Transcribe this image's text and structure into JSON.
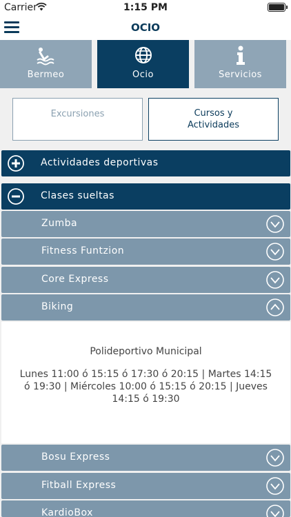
{
  "status": {
    "carrier": "Carrier",
    "time": "1:15 PM"
  },
  "nav": {
    "title": "OCIO"
  },
  "tabs": [
    {
      "label": "Bermeo",
      "icon": "swimmer-icon"
    },
    {
      "label": "Ocio",
      "icon": "globe-icon"
    },
    {
      "label": "Servicios",
      "icon": "info-icon"
    }
  ],
  "segments": {
    "excursiones": "Excursiones",
    "cursos_line1": "Cursos y",
    "cursos_line2": "Actividades"
  },
  "sections": {
    "deportivas": "Actividades deportivas",
    "clases": "Clases sueltas"
  },
  "items": {
    "zumba": "Zumba",
    "fitness": "Fitness Funtzion",
    "core": "Core Express",
    "biking": "Biking",
    "bosu": "Bosu Express",
    "fitball": "Fitball Express",
    "kardio": "KardioBox"
  },
  "detail": {
    "place": "Polideportivo Municipal",
    "hours": "Lunes 11:00 ó 15:15 ó 17:30 ó 20:15 | Martes 14:15 ó 19:30 | Miércoles 10:00 ó 15:15 ó 20:15 | Jueves 14:15 ó 19:30"
  },
  "colors": {
    "primary": "#0a3e61",
    "secondary": "#7d97ab",
    "tab_inactive": "#8fa5b6"
  }
}
